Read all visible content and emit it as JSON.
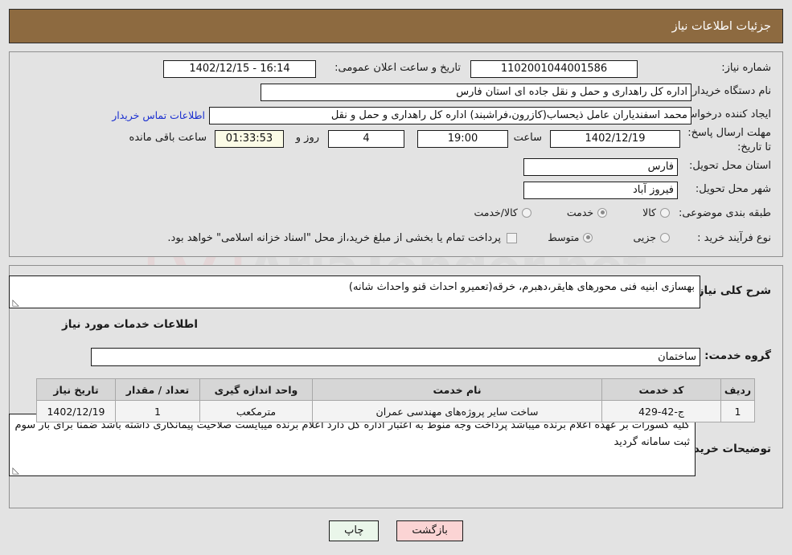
{
  "header": {
    "title": "جزئیات اطلاعات نیاز"
  },
  "watermark": {
    "text": "AriaTender.net"
  },
  "colors": {
    "header_bg": "#8d6a40",
    "page_bg": "#e3e3e3",
    "link": "#1a2fd0",
    "btn_print_bg": "#eaf6ea",
    "btn_back_bg": "#fbd4d4",
    "countdown_bg": "#fbfbe6",
    "service_name": "#7a3a1e"
  },
  "top_form": {
    "need_number_label": "شماره نیاز:",
    "need_number_value": "1102001044001586",
    "announce_datetime_label": "تاریخ و ساعت اعلان عمومی:",
    "announce_datetime_value": "16:14 - 1402/12/15",
    "buyer_org_label": "نام دستگاه خریدار:",
    "buyer_org_value": "اداره کل راهداری و حمل و نقل جاده ای استان فارس",
    "requester_label": "ایجاد کننده درخواست:",
    "requester_value": "محمد اسفندیاران عامل ذیحساب(کازرون،فراشبند) اداره کل راهداری و حمل و نقل",
    "contact_link": "اطلاعات تماس خریدار",
    "deadline_label": "مهلت ارسال پاسخ: تا تاریخ:",
    "deadline_date": "1402/12/19",
    "deadline_time_label": "ساعت",
    "deadline_time": "19:00",
    "remaining_days": "4",
    "days_and_label": "روز و",
    "countdown": "01:33:53",
    "countdown_suffix": "ساعت باقی مانده",
    "province_label": "استان محل تحویل:",
    "province_value": "فارس",
    "city_label": "شهر محل تحویل:",
    "city_value": "فیروز آباد",
    "category_label": "طبقه بندی موضوعی:",
    "category_options": [
      {
        "label": "کالا",
        "selected": false
      },
      {
        "label": "خدمت",
        "selected": true
      },
      {
        "label": "کالا/خدمت",
        "selected": false
      }
    ],
    "process_label": "نوع فرآیند خرید :",
    "process_options": [
      {
        "label": "جزیی",
        "selected": false
      },
      {
        "label": "متوسط",
        "selected": true
      }
    ],
    "treasury_checkbox_checked": false,
    "treasury_note": "پرداخت تمام یا بخشی از مبلغ خرید،از محل \"اسناد خزانه اسلامی\" خواهد بود."
  },
  "middle": {
    "general_desc_label": "شرح کلی نیاز:",
    "general_desc_value": "بهسازی ابنیه فنی محورهای هایقر،دهبرم، خرقه(تعمیرو احداث قنو واحداث شانه)",
    "services_section_title": "اطلاعات خدمات مورد نیاز",
    "service_group_label": "گروه خدمت:",
    "service_group_value": "ساختمان"
  },
  "table": {
    "headers": [
      "ردیف",
      "کد خدمت",
      "نام خدمت",
      "واحد اندازه گیری",
      "تعداد / مقدار",
      "تاریخ نیاز"
    ],
    "rows": [
      {
        "row": "1",
        "code": "ج-42-429",
        "name": "ساخت سایر پروژه‌های مهندسی عمران",
        "unit": "مترمکعب",
        "quantity": "1",
        "need_date": "1402/12/19"
      }
    ]
  },
  "buyer_notes": {
    "label": "توضیحات خریدار:",
    "value": "کلیه کسورات بر عهده اعلام برنده میباشد پرداخت وجه منوط به اعتبار اداره کل دارد اعلام برنده میبایست صلاحیت پیمانکاری داشته باشد ضمنا برای بار سوم ثبت سامانه گردید"
  },
  "buttons": {
    "print": "چاپ",
    "back": "بازگشت"
  }
}
